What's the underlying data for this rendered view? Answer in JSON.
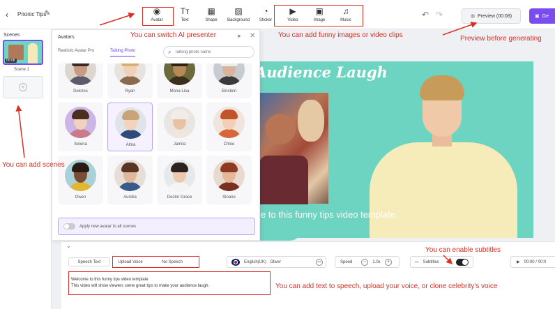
{
  "topbar": {
    "project_title": "Prionic Tips",
    "tools": [
      {
        "label": "Avatar",
        "icon": "avatar-icon",
        "glyph": "◉"
      },
      {
        "label": "Text",
        "icon": "text-icon",
        "glyph": "Tт"
      },
      {
        "label": "Shape",
        "icon": "shape-icon",
        "glyph": "▦"
      },
      {
        "label": "Background",
        "icon": "background-icon",
        "glyph": "▨"
      },
      {
        "label": "Sticker",
        "icon": "sticker-icon",
        "glyph": "◔"
      },
      {
        "label": "Video",
        "icon": "video-icon",
        "glyph": "▶"
      },
      {
        "label": "Image",
        "icon": "image-icon",
        "glyph": "▣"
      },
      {
        "label": "Music",
        "icon": "music-icon",
        "glyph": "♫"
      }
    ],
    "preview_label": "Preview (00:08)",
    "generate_label": "Ge"
  },
  "scenes": {
    "title": "Scenes",
    "thumb_duration": "00:08",
    "scene_label": "Scene 1"
  },
  "canvas": {
    "title": "Audience Laugh",
    "subtitle": "e to this funny tips video template."
  },
  "avatar_panel": {
    "title": "Avatars",
    "tabs": [
      "Realistic Avatar Pro",
      "Talking Photo"
    ],
    "search_placeholder": "Talking photo name",
    "avatars": [
      {
        "name": "Delores",
        "skin": "#c99a83",
        "hair": "#3a2a24",
        "shirt": "#5a5a6a",
        "bg": "#dcd6cf"
      },
      {
        "name": "Ryan",
        "skin": "#efd0b8",
        "hair": "#d9b070",
        "shirt": "#8a6a4a",
        "bg": "#e8e2dc"
      },
      {
        "name": "Mona Lisa",
        "skin": "#b68a52",
        "hair": "#2e2214",
        "shirt": "#3a2e1c",
        "bg": "#6b6a3c"
      },
      {
        "name": "Einstein",
        "skin": "#d9b49a",
        "hair": "#eeeeee",
        "shirt": "#3a3a3a",
        "bg": "#c8cbd0"
      },
      {
        "name": "Selena",
        "skin": "#f2d2be",
        "hair": "#4a2e22",
        "shirt": "#c87b8a",
        "bg": "#cbb6e6"
      },
      {
        "name": "Alma",
        "skin": "#f3d3bd",
        "hair": "#c9a478",
        "shirt": "#2f4a78",
        "bg": "#dfe3ea"
      },
      {
        "name": "Jamila",
        "skin": "#e8c2a4",
        "hair": "#f1ece6",
        "shirt": "#efe7de",
        "bg": "#e9e6e2"
      },
      {
        "name": "Chloe",
        "skin": "#f4cfb6",
        "hair": "#c0542a",
        "shirt": "#d6673a",
        "bg": "#f0e4dc"
      },
      {
        "name": "Owen",
        "skin": "#7a4e33",
        "hair": "#2a1a12",
        "shirt": "#e2b632",
        "bg": "#a9d1d8"
      },
      {
        "name": "Aurelia",
        "skin": "#e0b89a",
        "hair": "#5a3424",
        "shirt": "#3a5a8a",
        "bg": "#e6dfd8"
      },
      {
        "name": "Doctor Grace",
        "skin": "#ecc8ae",
        "hair": "#2b2220",
        "shirt": "#f4f4f4",
        "bg": "#e6e8ea"
      },
      {
        "name": "Sloane",
        "skin": "#e5b89a",
        "hair": "#8c3a22",
        "shirt": "#7a3020",
        "bg": "#ead9d0"
      }
    ],
    "apply_all_label": "Apply new avatar to all scenes"
  },
  "script_panel": {
    "tabs": [
      "Speech Text",
      "Upload Voice",
      "No Speech"
    ],
    "voice": "English(UK) · Oliver",
    "speed_label": "Speed",
    "speed_value": "1.0x",
    "subtitles_label": "Subtitles",
    "subtitles_on": true,
    "player_time": "00:00 / 00:0",
    "script_lines": [
      "Welcome to this funny tips video template",
      "This video will show viewers some great tips to make your audience laugh."
    ]
  },
  "annotations": {
    "switch_presenter": "You can switch AI presenter",
    "add_media": "You can add funny images or video clips",
    "preview": "Preview before generating",
    "add_scenes": "You can add scenes",
    "enable_subtitles": "You can enable subtitles",
    "tts": "You can add text to speech, upload your voice, or clone celebrity's voice",
    "color": "#d93025"
  }
}
